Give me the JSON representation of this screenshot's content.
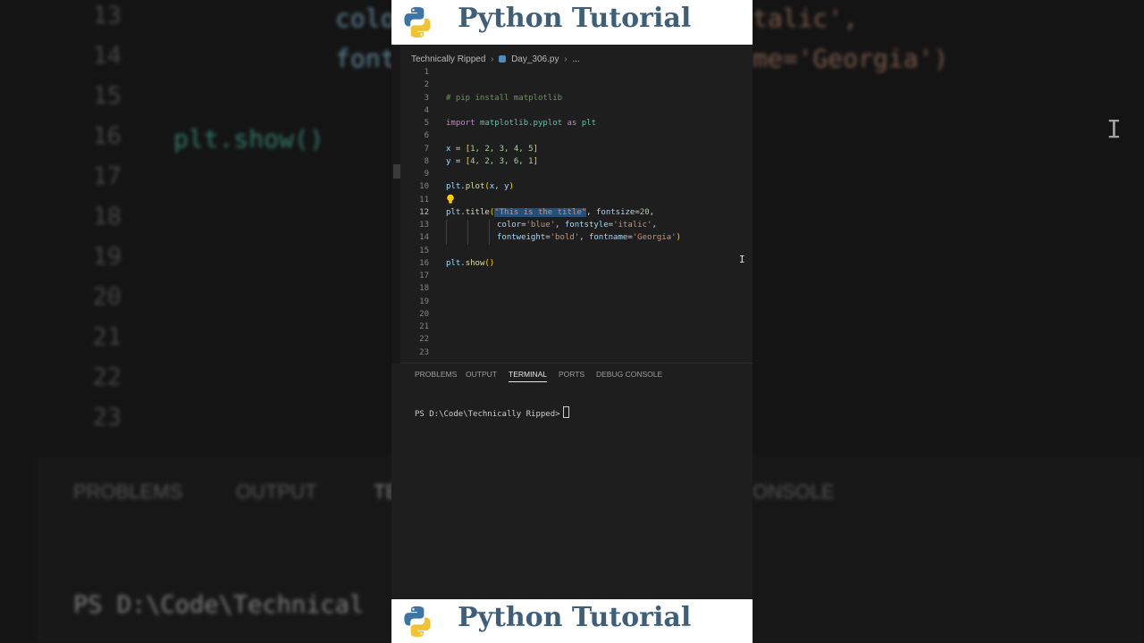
{
  "banner": {
    "title": "Python Tutorial"
  },
  "breadcrumb": {
    "folder": "Technically Ripped",
    "file": "Day_306.py",
    "ellipsis": "..."
  },
  "editor": {
    "line_numbers": [
      "1",
      "2",
      "3",
      "4",
      "5",
      "6",
      "7",
      "8",
      "9",
      "10",
      "11",
      "12",
      "13",
      "14",
      "15",
      "16",
      "17",
      "18",
      "19",
      "20",
      "21",
      "22",
      "23"
    ],
    "active_line": "12",
    "lines": {
      "l3": {
        "comment": "# pip install matplotlib"
      },
      "l5": {
        "kw_import": "import",
        "module": "matplotlib.pyplot",
        "kw_as": "as",
        "alias": "plt"
      },
      "l7": {
        "var": "x",
        "eq": " = ",
        "open": "[",
        "values": "1, 2, 3, 4, 5",
        "close": "]"
      },
      "l8": {
        "var": "y",
        "eq": " = ",
        "open": "[",
        "values": "4, 2, 3, 6, 1",
        "close": "]"
      },
      "l10": {
        "obj": "plt",
        "dot": ".",
        "fn": "plot",
        "open": "(",
        "args": "x, y",
        "close": ")"
      },
      "l12": {
        "obj": "plt",
        "dot": ".",
        "fn": "title",
        "open": "(",
        "str": "\"This is the title\"",
        "comma": ", ",
        "param": "fontsize",
        "eq": "=",
        "num": "20",
        "trail": ","
      },
      "l13": {
        "p1": "color",
        "eq1": "=",
        "v1": "'blue'",
        "sep": ", ",
        "p2": "fontstyle",
        "eq2": "=",
        "v2": "'italic'",
        "trail": ","
      },
      "l14": {
        "p1": "fontweight",
        "eq1": "=",
        "v1": "'bold'",
        "sep": ", ",
        "p2": "fontname",
        "eq2": "=",
        "v2": "'Georgia'",
        "close": ")"
      },
      "l16": {
        "obj": "plt",
        "dot": ".",
        "fn": "show",
        "paren": "()"
      }
    }
  },
  "panel_tabs": [
    "PROBLEMS",
    "OUTPUT",
    "TERMINAL",
    "PORTS",
    "DEBUG CONSOLE"
  ],
  "active_tab": "TERMINAL",
  "terminal": {
    "prompt": "PS D:\\Code\\Technically Ripped>"
  },
  "background": {
    "line_numbers": [
      "13",
      "14",
      "15",
      "16",
      "17",
      "18",
      "19",
      "20",
      "21",
      "22",
      "23"
    ],
    "code_l13": "colo",
    "code_l13_right": "talic',",
    "code_l14": "font",
    "code_l14_right": "me='Georgia')",
    "code_l16": "plt.show()",
    "tabs": [
      "PROBLEMS",
      "OUTPUT",
      "TE",
      "ONSOLE"
    ],
    "prompt": "PS D:\\Code\\Technical"
  },
  "colors": {
    "banner_text": "#3e5f7a",
    "editor_bg": "#1e1e1e",
    "selection": "#264f78"
  },
  "icons": {
    "logo": "python-logo-icon",
    "bulb": "lightbulb-icon",
    "file": "python-file-icon",
    "chevron": "chevron-right-icon"
  }
}
